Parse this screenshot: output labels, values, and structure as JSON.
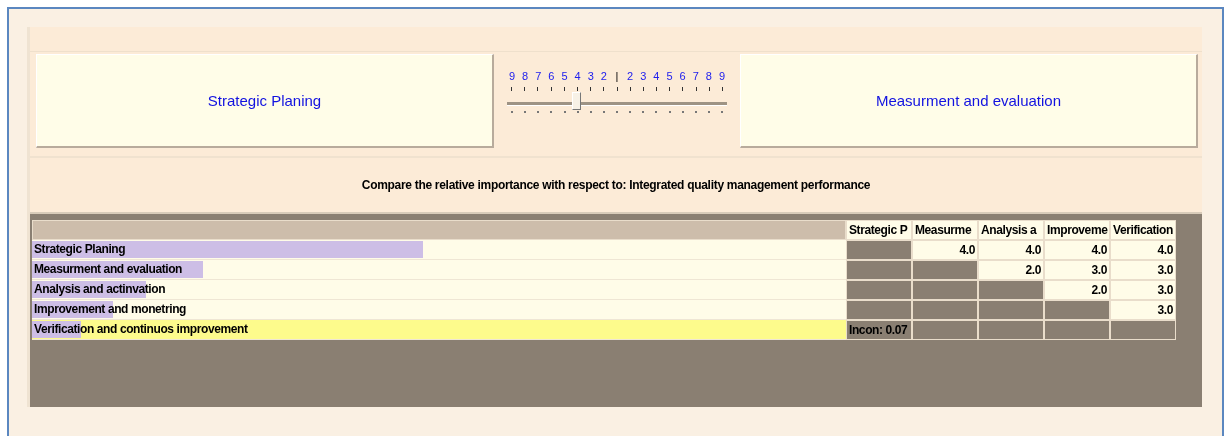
{
  "left_option": {
    "label": "Strategic Planing"
  },
  "right_option": {
    "label": "Measurment and evaluation"
  },
  "scale": {
    "labels": [
      "9",
      "8",
      "7",
      "6",
      "5",
      "4",
      "3",
      "2",
      "|",
      "2",
      "3",
      "4",
      "5",
      "6",
      "7",
      "8",
      "9"
    ],
    "level": 0.3125
  },
  "prompt": "Compare the relative importance with respect to: Integrated quality management performance",
  "table": {
    "columns": [
      "Strategic P",
      "Measurme",
      "Analysis a",
      "Improveme",
      "Verification"
    ],
    "rows": [
      {
        "name": "Strategic Planing",
        "level": 0.48,
        "selected": false,
        "cells": [
          {
            "kind": "empty"
          },
          {
            "kind": "value",
            "text": "4.0"
          },
          {
            "kind": "value",
            "text": "4.0"
          },
          {
            "kind": "value",
            "text": "4.0"
          },
          {
            "kind": "value",
            "text": "4.0"
          }
        ]
      },
      {
        "name": "Measurment and evaluation",
        "level": 0.21,
        "selected": false,
        "cells": [
          {
            "kind": "empty"
          },
          {
            "kind": "empty"
          },
          {
            "kind": "value",
            "text": "2.0"
          },
          {
            "kind": "value",
            "text": "3.0"
          },
          {
            "kind": "value",
            "text": "3.0"
          }
        ]
      },
      {
        "name": "Analysis and actinvation",
        "level": 0.14,
        "selected": false,
        "cells": [
          {
            "kind": "empty"
          },
          {
            "kind": "empty"
          },
          {
            "kind": "empty"
          },
          {
            "kind": "value",
            "text": "2.0"
          },
          {
            "kind": "value",
            "text": "3.0"
          }
        ]
      },
      {
        "name": "Improvement and monetring",
        "level": 0.1,
        "selected": false,
        "cells": [
          {
            "kind": "empty"
          },
          {
            "kind": "empty"
          },
          {
            "kind": "empty"
          },
          {
            "kind": "empty"
          },
          {
            "kind": "value",
            "text": "3.0"
          }
        ]
      },
      {
        "name": "Verification and continuos improvement",
        "level": 0.06,
        "selected": true,
        "cells": [
          {
            "kind": "note",
            "text": "Incon: 0.07"
          },
          {
            "kind": "empty"
          },
          {
            "kind": "empty"
          },
          {
            "kind": "empty"
          },
          {
            "kind": "empty"
          }
        ]
      }
    ]
  }
}
